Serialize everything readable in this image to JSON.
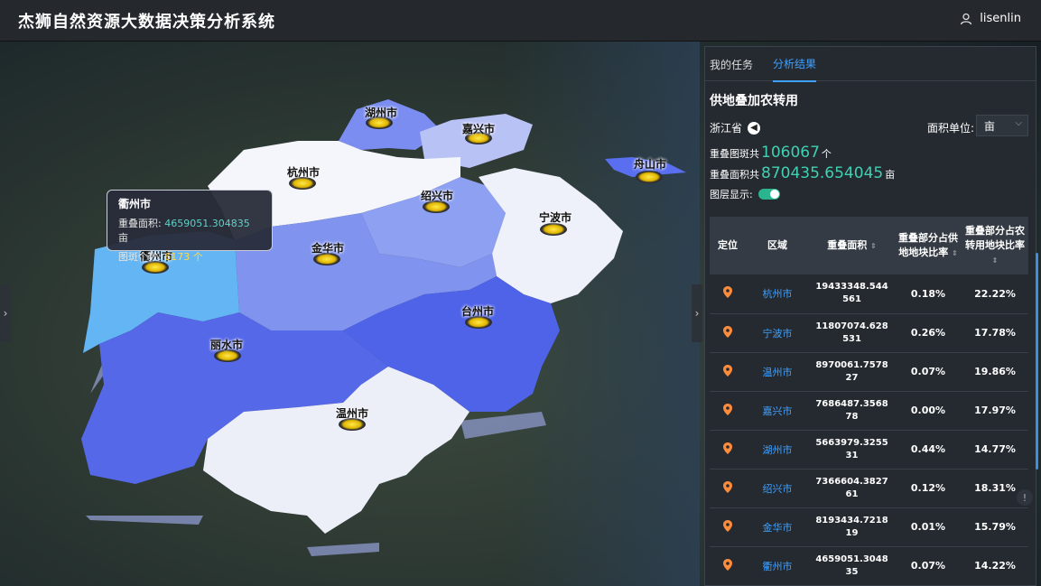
{
  "app": {
    "title": "杰狮自然资源大数据决策分析系统"
  },
  "user": {
    "name": "lisenlin",
    "icon": "user-icon"
  },
  "map": {
    "cities": [
      {
        "name": "湖州市"
      },
      {
        "name": "嘉兴市"
      },
      {
        "name": "杭州市"
      },
      {
        "name": "舟山市"
      },
      {
        "name": "绍兴市"
      },
      {
        "name": "宁波市"
      },
      {
        "name": "金华市"
      },
      {
        "name": "衢州市"
      },
      {
        "name": "台州市"
      },
      {
        "name": "丽水市"
      },
      {
        "name": "温州市"
      }
    ],
    "tooltip": {
      "title": "衢州市",
      "area_label": "重叠面积:",
      "area_value": "4659051.304835",
      "area_unit": "亩",
      "count_label": "图斑个数:",
      "count_value": "6173",
      "count_unit": "个"
    }
  },
  "panel": {
    "tabs": [
      {
        "label": "我的任务"
      },
      {
        "label": "分析结果"
      }
    ],
    "title": "供地叠加农转用",
    "province": "浙江省",
    "unit_label": "面积单位:",
    "unit_value": "亩",
    "stats": {
      "count_label": "重叠图斑共",
      "count_value": "106067",
      "count_unit": "个",
      "area_label": "重叠面积共",
      "area_value": "870435.654045",
      "area_unit": "亩"
    },
    "layer_label": "图层显示:",
    "table": {
      "headers": [
        "定位",
        "区域",
        "重叠面积",
        "重叠部分占供地地块比率",
        "重叠部分占农转用地块比率"
      ],
      "rows": [
        {
          "area": "杭州市",
          "size": "19433348.544561",
          "supply": "0.18%",
          "farm": "22.22%"
        },
        {
          "area": "宁波市",
          "size": "11807074.628531",
          "supply": "0.26%",
          "farm": "17.78%"
        },
        {
          "area": "温州市",
          "size": "8970061.757827",
          "supply": "0.07%",
          "farm": "19.86%"
        },
        {
          "area": "嘉兴市",
          "size": "7686487.356878",
          "supply": "0.00%",
          "farm": "17.97%"
        },
        {
          "area": "湖州市",
          "size": "5663979.325531",
          "supply": "0.44%",
          "farm": "14.77%"
        },
        {
          "area": "绍兴市",
          "size": "7366604.382761",
          "supply": "0.12%",
          "farm": "18.31%"
        },
        {
          "area": "金华市",
          "size": "8193434.721819",
          "supply": "0.01%",
          "farm": "15.79%"
        },
        {
          "area": "衢州市",
          "size": "4659051.304835",
          "supply": "0.07%",
          "farm": "14.22%"
        }
      ]
    }
  },
  "colors": {
    "accent": "#3fa0ff",
    "highlight": "#3fd1b2",
    "topbar": "#25282c",
    "panel": "#252a30"
  }
}
